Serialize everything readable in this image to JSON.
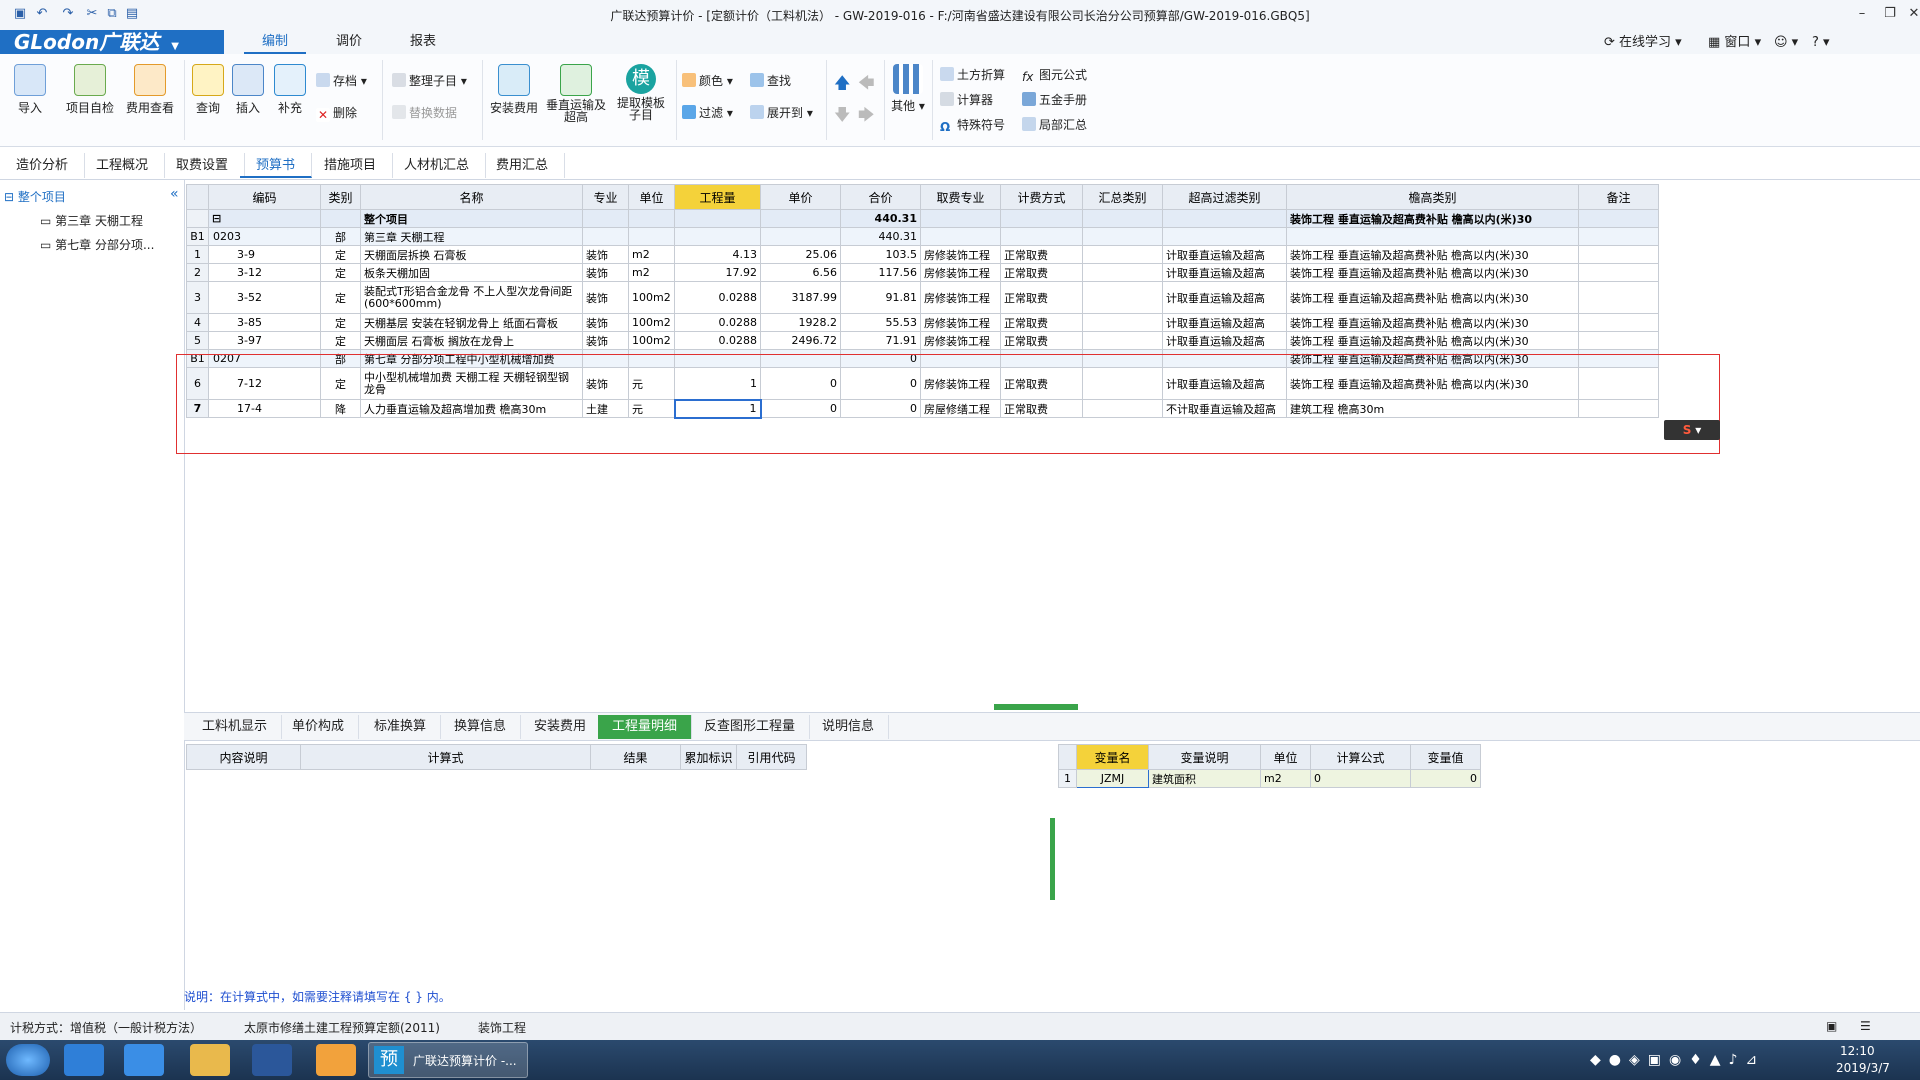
{
  "window": {
    "title": "广联达预算计价 - [定额计价（工料机法） - GW-2019-016 - F:/河南省盛达建设有限公司长治分公司预算部/GW-2019-016.GBQ5]"
  },
  "app": {
    "logo": "GLodon广联达"
  },
  "menu": {
    "items": [
      "编制",
      "调价",
      "报表"
    ],
    "online": "在线学习",
    "window": "窗口"
  },
  "ribbon": {
    "big": [
      "导入",
      "项目自检",
      "费用查看",
      "查询",
      "插入",
      "补充",
      "安装费用",
      "垂直运输及超高",
      "提取模板子目",
      "其他"
    ],
    "small": [
      "存档",
      "删除",
      "整理子目",
      "替换数据",
      "颜色",
      "查找",
      "过滤",
      "展开到",
      "土方折算",
      "计算器",
      "特殊符号",
      "图元公式",
      "五金手册",
      "局部汇总"
    ],
    "mo": "模"
  },
  "tabs": [
    "造价分析",
    "工程概况",
    "取费设置",
    "预算书",
    "措施项目",
    "人材机汇总",
    "费用汇总"
  ],
  "tree": {
    "root": "整个项目",
    "children": [
      "第三章 天棚工程",
      "第七章 分部分项..."
    ]
  },
  "grid": {
    "headers": [
      "编码",
      "类别",
      "名称",
      "专业",
      "单位",
      "工程量",
      "单价",
      "合价",
      "取费专业",
      "计费方式",
      "汇总类别",
      "超高过滤类别",
      "檐高类别",
      "备注"
    ],
    "top": {
      "name": "整个项目",
      "total": "440.31",
      "eaves": "装饰工程 垂直运输及超高费补贴 檐高以内(米)30"
    },
    "rows": [
      {
        "no": "B1",
        "code": "0203",
        "type": "部",
        "name": "第三章 天棚工程",
        "spec": "",
        "unit": "",
        "qty": "",
        "price": "",
        "total": "440.31",
        "fee": "",
        "mode": "",
        "sum": "",
        "filter": "",
        "eaves": "",
        "group": true
      },
      {
        "no": "1",
        "code": "3-9",
        "type": "定",
        "name": "天棚面层拆换 石膏板",
        "spec": "装饰",
        "unit": "m2",
        "qty": "4.13",
        "price": "25.06",
        "total": "103.5",
        "fee": "房修装饰工程",
        "mode": "正常取费",
        "sum": "",
        "filter": "计取垂直运输及超高",
        "eaves": "装饰工程 垂直运输及超高费补贴 檐高以内(米)30"
      },
      {
        "no": "2",
        "code": "3-12",
        "type": "定",
        "name": "板条天棚加固",
        "spec": "装饰",
        "unit": "m2",
        "qty": "17.92",
        "price": "6.56",
        "total": "117.56",
        "fee": "房修装饰工程",
        "mode": "正常取费",
        "sum": "",
        "filter": "计取垂直运输及超高",
        "eaves": "装饰工程 垂直运输及超高费补贴 檐高以内(米)30"
      },
      {
        "no": "3",
        "code": "3-52",
        "type": "定",
        "name": "装配式T形铝合金龙骨 不上人型次龙骨间距(600*600mm)",
        "spec": "装饰",
        "unit": "100m2",
        "qty": "0.0288",
        "price": "3187.99",
        "total": "91.81",
        "fee": "房修装饰工程",
        "mode": "正常取费",
        "sum": "",
        "filter": "计取垂直运输及超高",
        "eaves": "装饰工程 垂直运输及超高费补贴 檐高以内(米)30",
        "tall": true
      },
      {
        "no": "4",
        "code": "3-85",
        "type": "定",
        "name": "天棚基层 安装在轻钢龙骨上 纸面石膏板",
        "spec": "装饰",
        "unit": "100m2",
        "qty": "0.0288",
        "price": "1928.2",
        "total": "55.53",
        "fee": "房修装饰工程",
        "mode": "正常取费",
        "sum": "",
        "filter": "计取垂直运输及超高",
        "eaves": "装饰工程 垂直运输及超高费补贴 檐高以内(米)30"
      },
      {
        "no": "5",
        "code": "3-97",
        "type": "定",
        "name": "天棚面层 石膏板 搁放在龙骨上",
        "spec": "装饰",
        "unit": "100m2",
        "qty": "0.0288",
        "price": "2496.72",
        "total": "71.91",
        "fee": "房修装饰工程",
        "mode": "正常取费",
        "sum": "",
        "filter": "计取垂直运输及超高",
        "eaves": "装饰工程 垂直运输及超高费补贴 檐高以内(米)30"
      },
      {
        "no": "B1",
        "code": "0207",
        "type": "部",
        "name": "第七章 分部分项工程中小型机械增加费",
        "spec": "",
        "unit": "",
        "qty": "",
        "price": "",
        "total": "0",
        "fee": "",
        "mode": "",
        "sum": "",
        "filter": "",
        "eaves": "装饰工程 垂直运输及超高费补贴 檐高以内(米)30",
        "group": true
      },
      {
        "no": "6",
        "code": "7-12",
        "type": "定",
        "name": "中小型机械增加费 天棚工程 天棚轻钢型钢龙骨",
        "spec": "装饰",
        "unit": "元",
        "qty": "1",
        "price": "0",
        "total": "0",
        "fee": "房修装饰工程",
        "mode": "正常取费",
        "sum": "",
        "filter": "计取垂直运输及超高",
        "eaves": "装饰工程 垂直运输及超高费补贴 檐高以内(米)30",
        "tall": true
      },
      {
        "no": "7",
        "code": "17-4",
        "type": "降",
        "name": "人力垂直运输及超高增加费 檐高30m",
        "spec": "土建",
        "unit": "元",
        "qty": "1",
        "price": "0",
        "total": "0",
        "fee": "房屋修缮工程",
        "mode": "正常取费",
        "sum": "",
        "filter": "不计取垂直运输及超高",
        "eaves": "建筑工程 檐高30m",
        "sel": true
      }
    ]
  },
  "bottom_tabs": [
    "工料机显示",
    "单价构成",
    "标准换算",
    "换算信息",
    "安装费用",
    "工程量明细",
    "反查图形工程量",
    "说明信息"
  ],
  "detail": {
    "headers": [
      "内容说明",
      "计算式",
      "结果",
      "累加标识",
      "引用代码"
    ]
  },
  "vars": {
    "headers": [
      "变量名",
      "变量说明",
      "单位",
      "计算公式",
      "变量值"
    ],
    "rows": [
      {
        "no": "1",
        "name": "JZMJ",
        "desc": "建筑面积",
        "unit": "m2",
        "formula": "0",
        "value": "0"
      }
    ]
  },
  "note": "说明：在计算式中，如需要注释请填写在 { } 内。",
  "status": {
    "tax": "计税方式：增值税（一般计税方法）",
    "quota": "太原市修缮土建工程预算定额(2011)",
    "major": "装饰工程"
  },
  "taskbar": {
    "app": "广联达预算计价 -...",
    "time": "12:10",
    "date": "2019/3/7"
  },
  "colors": {
    "brand": "#1f6fc4",
    "active_tab": "#3aa44a",
    "highlight_header": "#f4d23a",
    "annotation": "#e03030"
  }
}
